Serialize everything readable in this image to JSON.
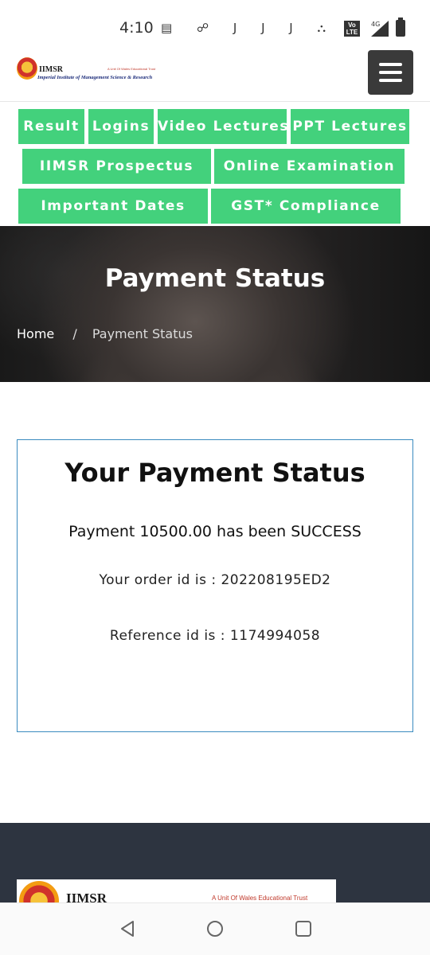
{
  "status_bar": {
    "time": "4:10",
    "left_icons": "▤ ☍ J J J ⛬ •",
    "volte_line1": "Vo",
    "volte_line2": "LTE",
    "network": "4G"
  },
  "header": {
    "logo_name": "IIMSR",
    "logo_tagline": "A Unit Of Wales Educational Trust",
    "logo_full_name": "Imperial Institute of Management Science & Research"
  },
  "nav_buttons": [
    {
      "label": "Result"
    },
    {
      "label": "Logins"
    },
    {
      "label": "Video Lectures"
    },
    {
      "label": "PPT Lectures"
    },
    {
      "label": "IIMSR Prospectus"
    },
    {
      "label": "Online Examination"
    },
    {
      "label": "Important Dates"
    },
    {
      "label": "GST* Compliance"
    }
  ],
  "hero": {
    "title": "Payment Status",
    "breadcrumb_home": "Home",
    "breadcrumb_separator": "/",
    "breadcrumb_current": "Payment Status"
  },
  "payment": {
    "heading": "Your Payment Status",
    "message": "Payment 10500.00 has been SUCCESS",
    "order_line": "Your order id is : 202208195ED2",
    "reference_line": "Reference id is : 1174994058"
  },
  "footer": {
    "logo_name": "IIMSR",
    "logo_tagline": "A Unit Of Wales Educational Trust"
  },
  "colors": {
    "button_green": "#43d17c",
    "card_border": "#3a8bbf",
    "footer_bg": "#2d3440",
    "menu_button": "#3a3a3a"
  },
  "icons": [
    "menu-icon",
    "signal-icon",
    "battery-icon",
    "back-icon",
    "home-icon",
    "recents-icon"
  ]
}
